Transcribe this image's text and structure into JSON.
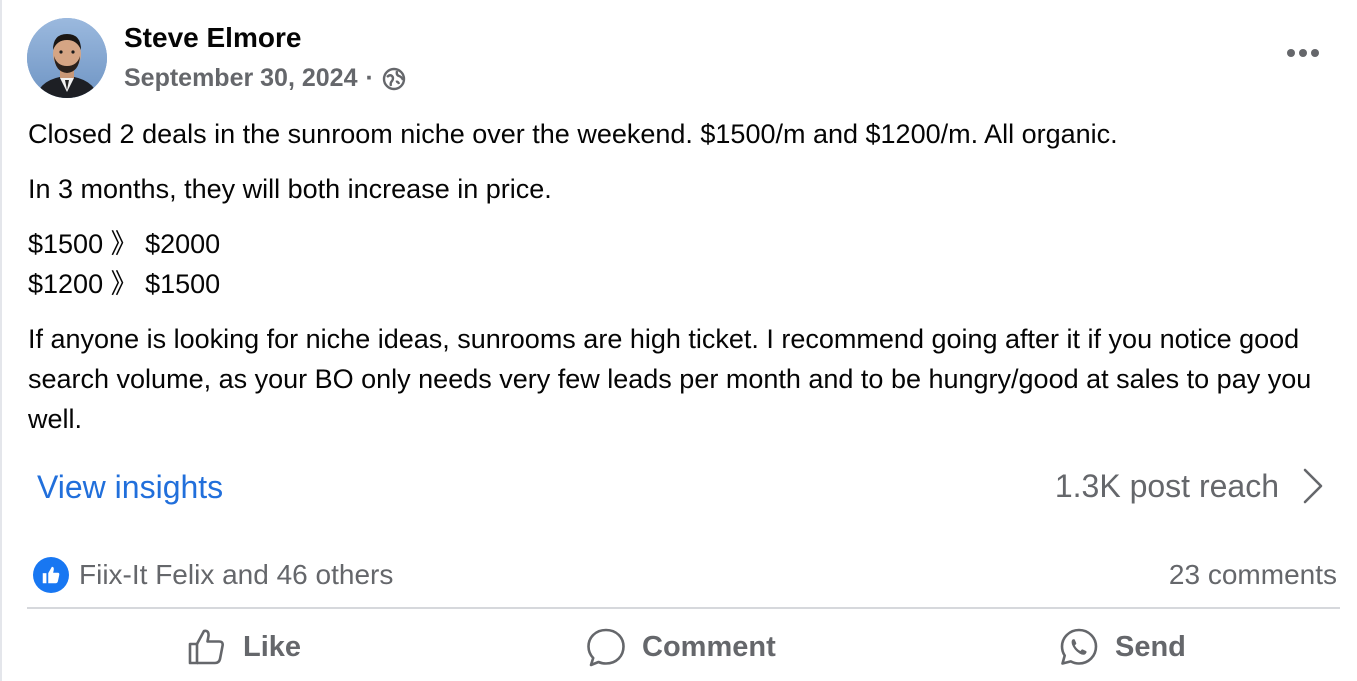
{
  "post": {
    "author": "Steve Elmore",
    "date": "September 30, 2024",
    "separator": "·",
    "audience_icon": "globe-icon",
    "paragraphs": [
      "Closed 2 deals in the sunroom niche over the weekend. $1500/m and $1200/m. All organic.",
      "In 3 months, they will both increase in price."
    ],
    "price_lines": [
      "$1500 》 $2000",
      "$1200 》 $1500"
    ],
    "closing_paragraph": "If anyone is looking for niche ideas, sunrooms are high ticket. I recommend going after it if you notice good search volume, as your BO only needs very few leads per month and to be hungry/good at sales to pay you well."
  },
  "insights": {
    "link_label": "View insights",
    "reach_label": "1.3K post reach"
  },
  "stats": {
    "reactions_label": "Fiix-It Felix and 46 others",
    "comments_label": "23 comments"
  },
  "actions": {
    "like": "Like",
    "comment": "Comment",
    "send": "Send"
  },
  "colors": {
    "link_blue": "#216fdb",
    "reaction_blue": "#1877f2",
    "muted_text": "#65676b",
    "primary_text": "#050505"
  }
}
